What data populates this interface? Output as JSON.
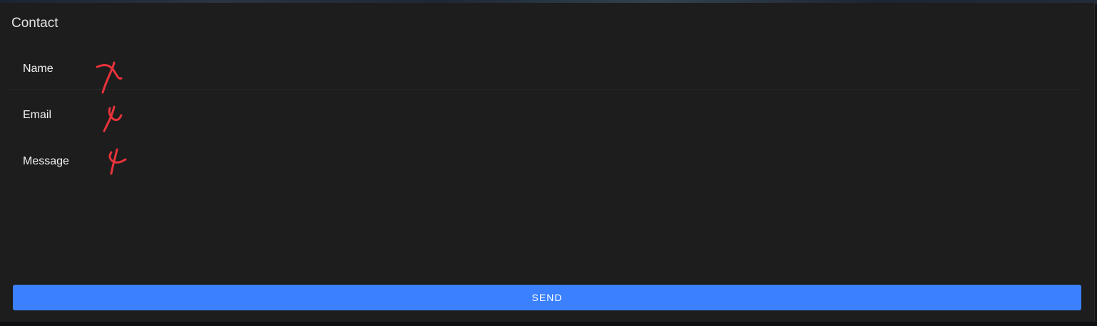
{
  "form": {
    "title": "Contact",
    "fields": [
      {
        "label": "Name",
        "value": ""
      },
      {
        "label": "Email",
        "value": ""
      },
      {
        "label": "Message",
        "value": ""
      }
    ],
    "submit_label": "SEND"
  },
  "colors": {
    "panel_bg": "#1d1d1d",
    "button_bg": "#3a80ff",
    "annotation": "#e8333b"
  }
}
